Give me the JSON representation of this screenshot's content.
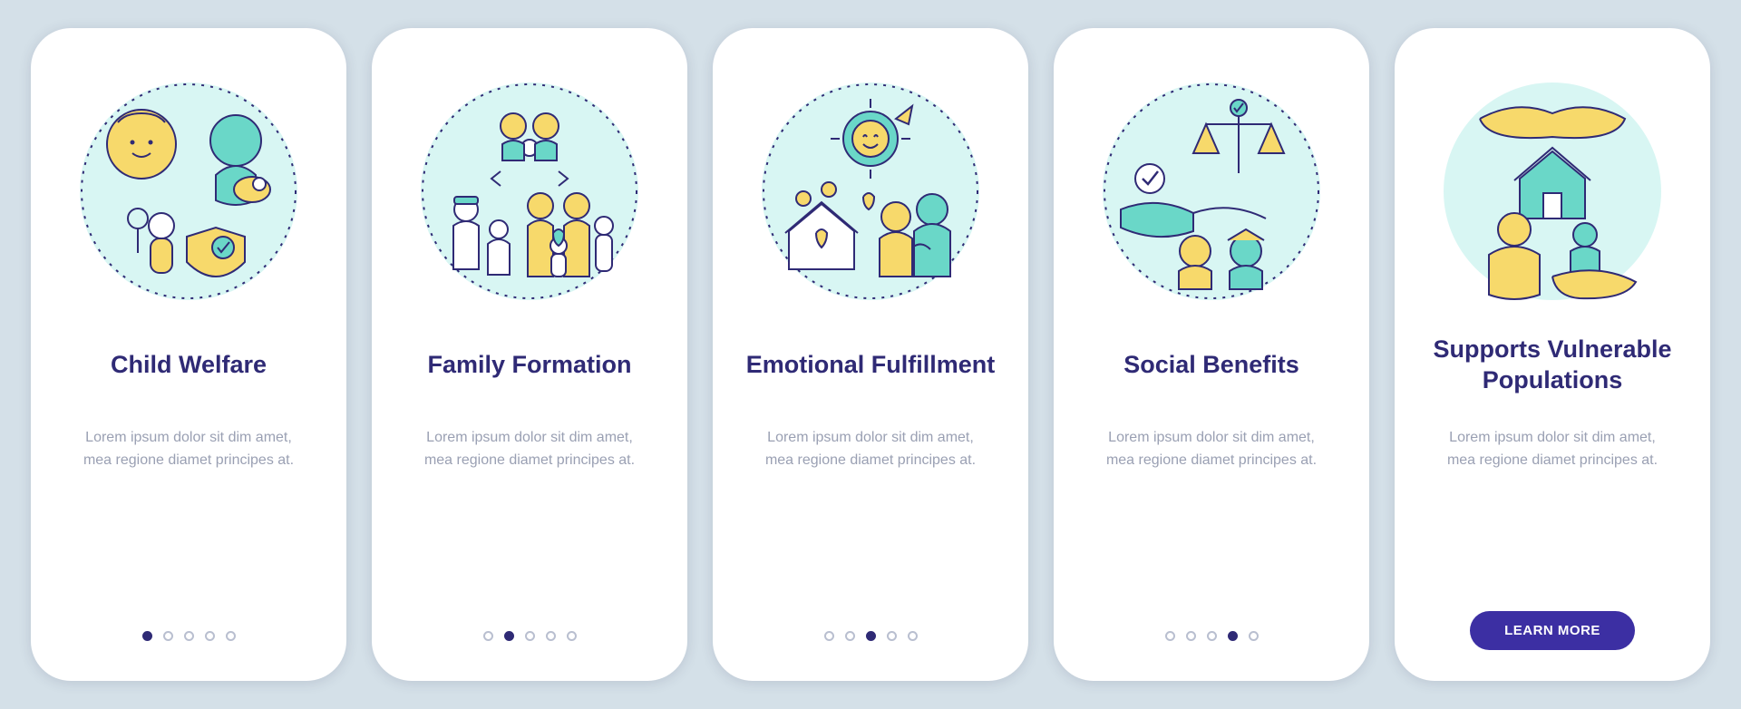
{
  "colors": {
    "bg": "#d4e0e8",
    "card": "#ffffff",
    "title": "#2f2a75",
    "desc": "#9aa0b3",
    "dot_inactive": "#b9bfd0",
    "dot_active": "#2f2a75",
    "cta": "#3c2fa3",
    "illus_stroke": "#2f2a75",
    "illus_yellow": "#f7d96b",
    "illus_teal": "#b8efe9",
    "illus_teal_dark": "#6ad7c8"
  },
  "cards": [
    {
      "title": "Child Welfare",
      "desc": "Lorem ipsum dolor sit dim amet, mea regione diamet principes at.",
      "icon_name": "child-welfare-icon",
      "active_index": 0,
      "has_cta": false
    },
    {
      "title": "Family Formation",
      "desc": "Lorem ipsum dolor sit dim amet, mea regione diamet principes at.",
      "icon_name": "family-formation-icon",
      "active_index": 1,
      "has_cta": false
    },
    {
      "title": "Emotional Fulfillment",
      "desc": "Lorem ipsum dolor sit dim amet, mea regione diamet principes at.",
      "icon_name": "emotional-fulfillment-icon",
      "active_index": 2,
      "has_cta": false
    },
    {
      "title": "Social Benefits",
      "desc": "Lorem ipsum dolor sit dim amet, mea regione diamet principes at.",
      "icon_name": "social-benefits-icon",
      "active_index": 3,
      "has_cta": false
    },
    {
      "title": "Supports Vulnerable Populations",
      "desc": "Lorem ipsum dolor sit dim amet, mea regione diamet principes at.",
      "icon_name": "vulnerable-populations-icon",
      "active_index": 4,
      "has_cta": true,
      "cta_label": "LEARN MORE"
    }
  ],
  "dot_count": 5
}
